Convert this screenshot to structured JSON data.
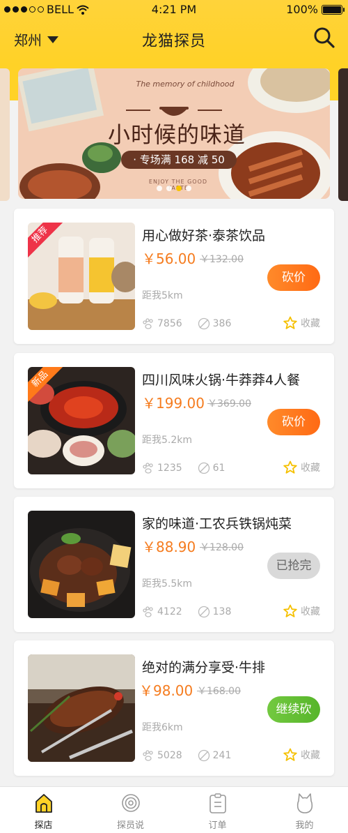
{
  "status_bar": {
    "carrier": "BELL",
    "time": "4:21 PM",
    "battery": "100%"
  },
  "nav": {
    "city": "郑州",
    "title": "龙猫探员"
  },
  "banner": {
    "english_caption": "The memory of childhood",
    "headline": "小时候的味道",
    "promo": "· 专场满 168 减 50",
    "bottom_caption": "ENJOY THE GOOD TASTE",
    "page_count": 4,
    "active_page": 3
  },
  "products": [
    {
      "title": "用心做好茶·泰茶饮品",
      "price": "￥56.00",
      "original_price": "￥132.00",
      "distance": "距我5km",
      "views": "7856",
      "count": "386",
      "fav_label": "收藏",
      "badge": "推荐",
      "badge_color": "#ee3348",
      "action": "砍价",
      "action_style": "orange"
    },
    {
      "title": "四川风味火锅·牛莽莽4人餐",
      "price": "￥199.00",
      "original_price": "￥369.00",
      "distance": "距我5.2km",
      "views": "1235",
      "count": "61",
      "fav_label": "收藏",
      "badge": "新品",
      "badge_color": "#ff7a1a",
      "action": "砍价",
      "action_style": "orange"
    },
    {
      "title": "家的味道·工农兵铁锅炖菜",
      "price": "￥88.90",
      "original_price": "￥128.00",
      "distance": "距我5.5km",
      "views": "4122",
      "count": "138",
      "fav_label": "收藏",
      "badge": "",
      "action": "已抢完",
      "action_style": "gray"
    },
    {
      "title": "绝对的满分享受·牛排",
      "price": "￥98.00",
      "original_price": "￥168.00",
      "distance": "距我6km",
      "views": "5028",
      "count": "241",
      "fav_label": "收藏",
      "badge": "",
      "action": "继续砍",
      "action_style": "green"
    }
  ],
  "tabs": [
    {
      "label": "探店",
      "icon": "shop-icon",
      "active": true
    },
    {
      "label": "探员说",
      "icon": "target-icon",
      "active": false
    },
    {
      "label": "订单",
      "icon": "clipboard-icon",
      "active": false
    },
    {
      "label": "我的",
      "icon": "cat-icon",
      "active": false
    }
  ],
  "colors": {
    "brand_yellow": "#ffd227",
    "price_orange": "#f57c1f",
    "star": "#f5c000"
  }
}
